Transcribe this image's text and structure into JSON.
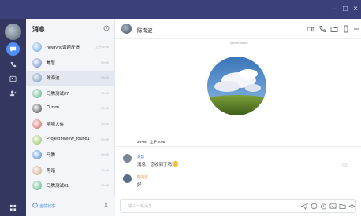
{
  "window": {
    "title_bar_color": "#3b3f7a",
    "controls": {
      "minimize": "–",
      "maximize": "□",
      "close": "×"
    }
  },
  "rail": {
    "items": [
      {
        "icon": "chat-bubble-icon",
        "active": true
      },
      {
        "icon": "phone-icon",
        "active": false
      },
      {
        "icon": "contacts-card-icon",
        "active": false
      },
      {
        "icon": "add-user-icon",
        "active": false
      }
    ],
    "apps_icon": "grid-apps-icon",
    "accent": "#4f8ff7"
  },
  "sidebar": {
    "title": "消息",
    "settings_icon": "gear-icon",
    "conversations": [
      {
        "name": "newlync课题反馈",
        "time": "上午 9:05",
        "avatar_color": "#5aa0e8"
      },
      {
        "name": "焦慧",
        "time": "09:00",
        "avatar_color": "#6b7fcf"
      },
      {
        "name": "陈海波",
        "time": "09:00",
        "avatar_color": "#6f8fb3"
      },
      {
        "name": "马腾测试07",
        "time": "09:00",
        "avatar_color": "#4caf7d"
      },
      {
        "name": "⭘ zym",
        "time": "09:00",
        "avatar_color": "#3a3a3a"
      },
      {
        "name": "嘻嘻大侠",
        "time": "09:00",
        "avatar_color": "#d9534f"
      },
      {
        "name": "Project review_round1",
        "time": "09:00",
        "avatar_color": "#8bc34a"
      },
      {
        "name": "马腾",
        "time": "09:00",
        "avatar_color": "#3f7fd8"
      },
      {
        "name": "黑暗",
        "time": "09:00",
        "avatar_color": "#c9a27a"
      },
      {
        "name": "马腾测试01",
        "time": "09:00",
        "avatar_color": "#4caf7d"
      }
    ],
    "footer_label": "当前状态",
    "footer_icon_right": "pin-icon"
  },
  "chat": {
    "title": "陈海波",
    "header_icons": [
      "video-call-icon",
      "phone-call-icon",
      "folder-icon",
      "mobile-icon",
      "menu-icon"
    ],
    "handle": "@chenhaibo",
    "timestamp": "20-05，上午 9:00",
    "messages": [
      {
        "name": "焦慧",
        "text": "消息，您收到了吗",
        "status": "已读",
        "name_color": "#3b6fd8"
      },
      {
        "name": "陈海波",
        "text": "好",
        "status": "",
        "name_color": "#e8873a"
      }
    ],
    "composer_placeholder": "输入一条消息",
    "composer_icons": [
      "send-icon",
      "emoji-icon",
      "timer-icon",
      "image-icon",
      "folder-open-icon",
      "sparkle-icon"
    ]
  }
}
